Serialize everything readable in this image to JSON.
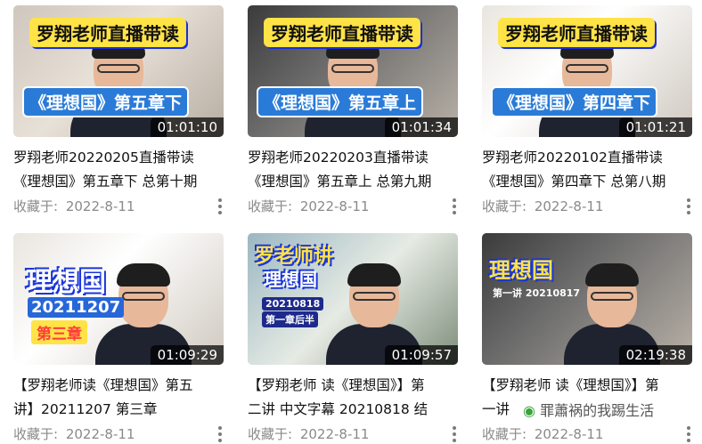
{
  "videos": [
    {
      "banner": "罗翔老师直播带读",
      "subbanner": "《理想国》第五章下",
      "duration": "01:01:10",
      "title_line1": "罗翔老师20220205直播带读",
      "title_line2": "《理想国》第五章下 总第十期",
      "saved_label": "收藏于:",
      "saved_date": "2022-8-11"
    },
    {
      "banner": "罗翔老师直播带读",
      "subbanner": "《理想国》第五章上",
      "duration": "01:01:34",
      "title_line1": "罗翔老师20220203直播带读",
      "title_line2": "《理想国》第五章上 总第九期",
      "saved_label": "收藏于:",
      "saved_date": "2022-8-11"
    },
    {
      "banner": "罗翔老师直播带读",
      "subbanner": "《理想国》第四章下",
      "duration": "01:01:21",
      "title_line1": "罗翔老师20220102直播带读",
      "title_line2": "《理想国》第四章下 总第八期",
      "saved_label": "收藏于:",
      "saved_date": "2022-8-11"
    },
    {
      "big_title": "理想国",
      "date_tag": "20211207",
      "chapter_tag": "第三章",
      "duration": "01:09:29",
      "title_line1": "【罗翔老师读《理想国》第五",
      "title_line2": "讲】20211207 第三章",
      "saved_label": "收藏于:",
      "saved_date": "2022-8-11"
    },
    {
      "big_title": "罗老师讲",
      "sub_title": "理想国",
      "date_tag": "20210818",
      "chapter_tag": "第一章后半",
      "duration": "01:09:57",
      "title_line1": "【罗翔老师 读《理想国》】第",
      "title_line2": "二讲 中文字幕 20210818 结",
      "saved_label": "收藏于:",
      "saved_date": "2022-8-11"
    },
    {
      "big_title": "理想国",
      "date_tag": "第一讲 20210817",
      "duration": "02:19:38",
      "title_line1": "【罗翔老师 读《理想国》】第",
      "title_line2": "一讲",
      "saved_label": "收藏于:",
      "saved_date": "2022-8-11"
    }
  ],
  "watermark": "罪蕭祸的我踢生活",
  "colors": {
    "banner_yellow": "#ffe347",
    "banner_blue": "#2a7bd8",
    "meta_gray": "#8a8a8a"
  }
}
